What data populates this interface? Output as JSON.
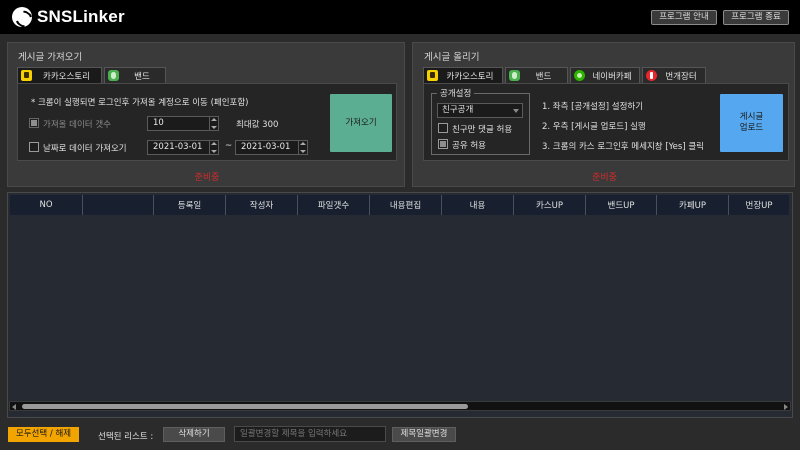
{
  "app": {
    "name": "SNSLinker",
    "buttons": {
      "guide": "프로그램 안내",
      "exit": "프로그램 종료"
    }
  },
  "import_panel": {
    "title": "게시글 가져오기",
    "tabs": [
      {
        "label": "카카오스토리",
        "icon": "kakaostory-icon",
        "active": true
      },
      {
        "label": "밴드",
        "icon": "band-icon",
        "active": false
      }
    ],
    "notice": "* 크롬이 실행되면 로그인후 가져올 계정으로 이동 (페인포함)",
    "count_label": "가져올 데이터 갯수",
    "count_value": "10",
    "max_label": "최대값 300",
    "date_label": "날짜로 데이터 가져오기",
    "date_from": "2021-03-01",
    "date_sep": "~",
    "date_to": "2021-03-01",
    "action_button": "가져오기",
    "status": "준비중"
  },
  "upload_panel": {
    "title": "게시글 올리기",
    "tabs": [
      {
        "label": "카카오스토리",
        "icon": "kakaostory-icon",
        "active": true
      },
      {
        "label": "밴드",
        "icon": "band-icon",
        "active": false
      },
      {
        "label": "네이버카페",
        "icon": "naver-cafe-icon",
        "active": false
      },
      {
        "label": "번개장터",
        "icon": "bungae-icon",
        "active": false
      }
    ],
    "group_title": "공개설정",
    "visibility_value": "친구공개",
    "comment_label": "친구만 댓글 허용",
    "share_label": "공유 허용",
    "steps": [
      "1. 좌측 [공개설정] 설정하기",
      "2. 우측 [게시글 업로드] 실행",
      "3. 크롬의 카스 로그인후 메세지창 [Yes] 클릭"
    ],
    "action_button_line1": "게시글",
    "action_button_line2": "업로드",
    "status": "준비중"
  },
  "table": {
    "columns": [
      "NO",
      "",
      "등록일",
      "작성자",
      "파일갯수",
      "내용편집",
      "내용",
      "카스UP",
      "밴드UP",
      "카페UP",
      "번장UP"
    ],
    "rows": []
  },
  "footer": {
    "select_all": "모두선택 / 해제",
    "selected_list_label": "선택된 리스트 :",
    "delete_button": "삭제하기",
    "title_input_placeholder": "일괄변경할 제목을 입력하세요",
    "bulk_change_button": "제목일괄변경"
  },
  "colors": {
    "accent_orange": "#f2a400",
    "import_button": "#5cae93",
    "upload_button": "#55a8ef",
    "status_red": "#d42b2b"
  }
}
